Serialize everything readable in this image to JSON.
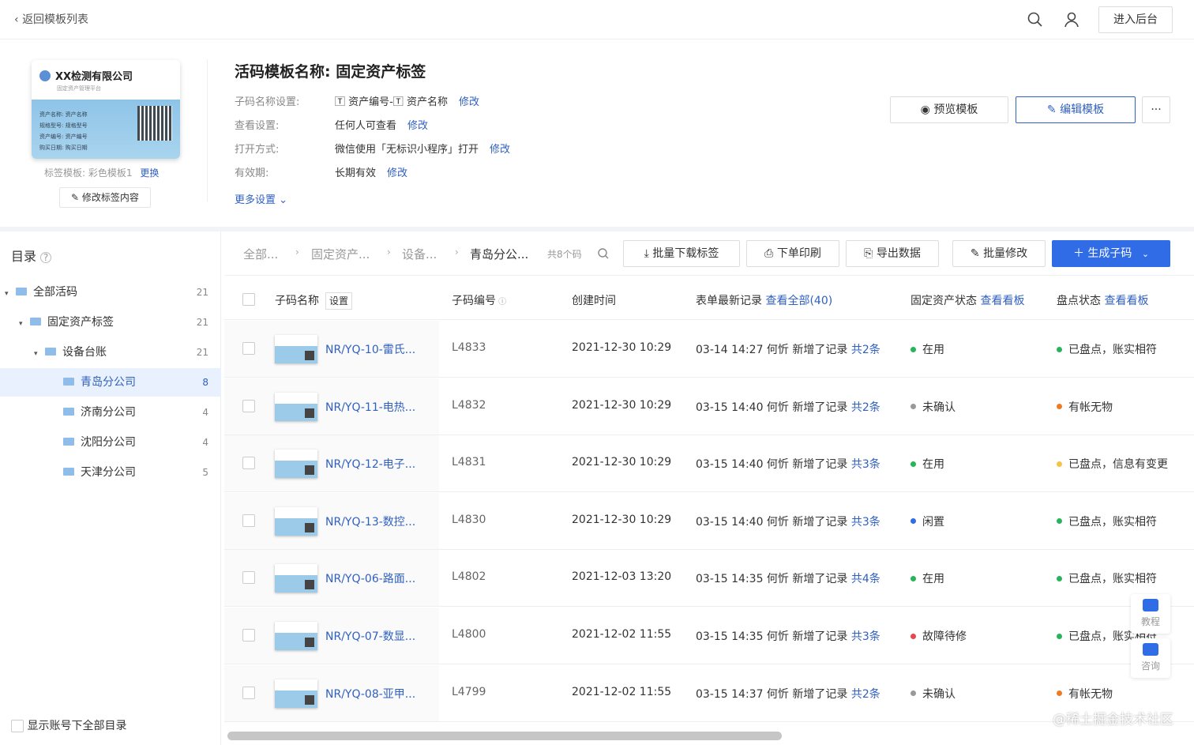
{
  "topbar": {
    "back_label": "返回模板列表",
    "enter_label": "进入后台"
  },
  "card": {
    "company": "XX检测有限公司",
    "subtitle": "固定资产管理平台",
    "lines": [
      "资产名称: 资产名称",
      "规格型号: 规格型号",
      "资产编号: 资产编号",
      "购买日期: 购买日期"
    ]
  },
  "template": {
    "label": "标签模板:",
    "value": "彩色模板1",
    "change": "更换",
    "edit_label_btn": "修改标签内容"
  },
  "header": {
    "title": "活码模板名称: 固定资产标签",
    "settings": [
      {
        "key": "子码名称设置:",
        "value": "🅃 资产编号-🅃 资产名称",
        "action": "修改"
      },
      {
        "key": "查看设置:",
        "value": "任何人可查看",
        "action": "修改"
      },
      {
        "key": "打开方式:",
        "value": "微信使用「无标识小程序」打开",
        "action": "修改"
      },
      {
        "key": "有效期:",
        "value": "长期有效",
        "action": "修改"
      }
    ],
    "more": "更多设置",
    "preview": "预览模板",
    "edit": "编辑模板",
    "dots": "···"
  },
  "sidebar": {
    "title": "目录",
    "tree": [
      {
        "label": "全部活码",
        "count": "21"
      },
      {
        "label": "固定资产标签",
        "count": "21"
      },
      {
        "label": "设备台账",
        "count": "21"
      },
      {
        "label": "青岛分公司",
        "count": "8"
      },
      {
        "label": "济南分公司",
        "count": "4"
      },
      {
        "label": "沈阳分公司",
        "count": "4"
      },
      {
        "label": "天津分公司",
        "count": "5"
      }
    ],
    "show_all": "显示账号下全部目录"
  },
  "toolbar": {
    "crumbs": [
      "全部...",
      "固定资产...",
      "设备...",
      "青岛分公..."
    ],
    "total": "共8个码",
    "batch_download": "批量下载标签",
    "print": "下单印刷",
    "export": "导出数据",
    "batch_edit": "批量修改",
    "generate": "生成子码"
  },
  "table": {
    "headers": {
      "name": "子码名称",
      "set": "设置",
      "code": "子码编号",
      "created": "创建时间",
      "record": "表单最新记录",
      "record_link": "查看全部(40)",
      "asset_status": "固定资产状态",
      "asset_link": "查看看板",
      "check_status": "盘点状态",
      "check_link": "查看看板"
    },
    "rows": [
      {
        "name": "NR/YQ-10-雷氏...",
        "code": "L4833",
        "created": "2021-12-30 10:29",
        "record": "03-14 14:27 何忻 新增了记录",
        "rec_count": "共2条",
        "asset": "在用",
        "asset_color": "#27b45a",
        "check": "已盘点，账实相符",
        "check_color": "#27b45a"
      },
      {
        "name": "NR/YQ-11-电热...",
        "code": "L4832",
        "created": "2021-12-30 10:29",
        "record": "03-15 14:40 何忻 新增了记录",
        "rec_count": "共2条",
        "asset": "未确认",
        "asset_color": "#999999",
        "check": "有帐无物",
        "check_color": "#f07a23"
      },
      {
        "name": "NR/YQ-12-电子...",
        "code": "L4831",
        "created": "2021-12-30 10:29",
        "record": "03-15 14:40 何忻 新增了记录",
        "rec_count": "共3条",
        "asset": "在用",
        "asset_color": "#27b45a",
        "check": "已盘点，信息有变更",
        "check_color": "#f5c542"
      },
      {
        "name": "NR/YQ-13-数控...",
        "code": "L4830",
        "created": "2021-12-30 10:29",
        "record": "03-15 14:40 何忻 新增了记录",
        "rec_count": "共3条",
        "asset": "闲置",
        "asset_color": "#2f6ce5",
        "check": "已盘点，账实相符",
        "check_color": "#27b45a"
      },
      {
        "name": "NR/YQ-06-路面...",
        "code": "L4802",
        "created": "2021-12-03 13:20",
        "record": "03-15 14:35 何忻 新增了记录",
        "rec_count": "共4条",
        "asset": "在用",
        "asset_color": "#27b45a",
        "check": "已盘点，账实相符",
        "check_color": "#27b45a"
      },
      {
        "name": "NR/YQ-07-数显...",
        "code": "L4800",
        "created": "2021-12-02 11:55",
        "record": "03-15 14:35 何忻 新增了记录",
        "rec_count": "共3条",
        "asset": "故障待修",
        "asset_color": "#e5484d",
        "check": "已盘点，账实相符",
        "check_color": "#27b45a"
      },
      {
        "name": "NR/YQ-08-亚甲...",
        "code": "L4799",
        "created": "2021-12-02 11:55",
        "record": "03-15 14:37 何忻 新增了记录",
        "rec_count": "共2条",
        "asset": "未确认",
        "asset_color": "#999999",
        "check": "有帐无物",
        "check_color": "#f07a23"
      }
    ]
  },
  "float": {
    "tutorial": "教程",
    "consult": "咨询"
  },
  "watermark": "@稀土掘金技术社区"
}
